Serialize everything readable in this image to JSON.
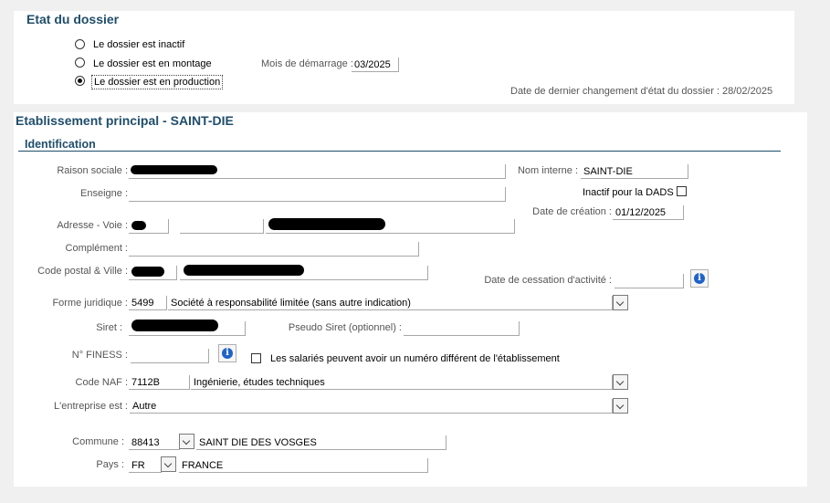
{
  "etat": {
    "title": "Etat du dossier",
    "options": [
      "Le dossier est inactif",
      "Le dossier est en montage",
      "Le dossier est en production"
    ],
    "selected_index": 2,
    "mois_label": "Mois de démarrage :",
    "mois_value": "03/2025",
    "last_change": "Date de dernier changement d'état du dossier : 28/02/2025"
  },
  "etab": {
    "title": "Etablissement principal - SAINT-DIE",
    "subtitle": "Identification",
    "raison_sociale_label": "Raison sociale :",
    "nom_interne_label": "Nom interne :",
    "nom_interne_value": "SAINT-DIE",
    "enseigne_label": "Enseigne :",
    "inactif_dads_label": "Inactif pour la DADS",
    "adresse_label": "Adresse - Voie :",
    "date_creation_label": "Date de création :",
    "date_creation_value": "01/12/2025",
    "complement_label": "Complément :",
    "cp_ville_label": "Code postal & Ville :",
    "date_cessation_label": "Date de cessation d'activité :",
    "forme_juridique_label": "Forme juridique :",
    "forme_juridique_code": "5499",
    "forme_juridique_text": "Société à responsabilité limitée (sans autre indication)",
    "siret_label": "Siret :",
    "pseudo_siret_label": "Pseudo Siret (optionnel) :",
    "finess_label": "N° FINESS :",
    "salaries_label": "Les salariés peuvent avoir un numéro différent de l'établissement",
    "naf_label": "Code NAF :",
    "naf_code": "7112B",
    "naf_text": "Ingénierie, études techniques",
    "entreprise_label": "L'entreprise est :",
    "entreprise_value": "Autre",
    "commune_label": "Commune :",
    "commune_code": "88413",
    "commune_name": "SAINT DIE DES VOSGES",
    "pays_label": "Pays :",
    "pays_code": "FR",
    "pays_name": "FRANCE"
  },
  "icons": {
    "info": "info-icon",
    "dropdown": "chevron-down-icon"
  },
  "colors": {
    "title": "#1f4e6b",
    "info": "#1f62c8",
    "underline": "#1f4e6b"
  }
}
